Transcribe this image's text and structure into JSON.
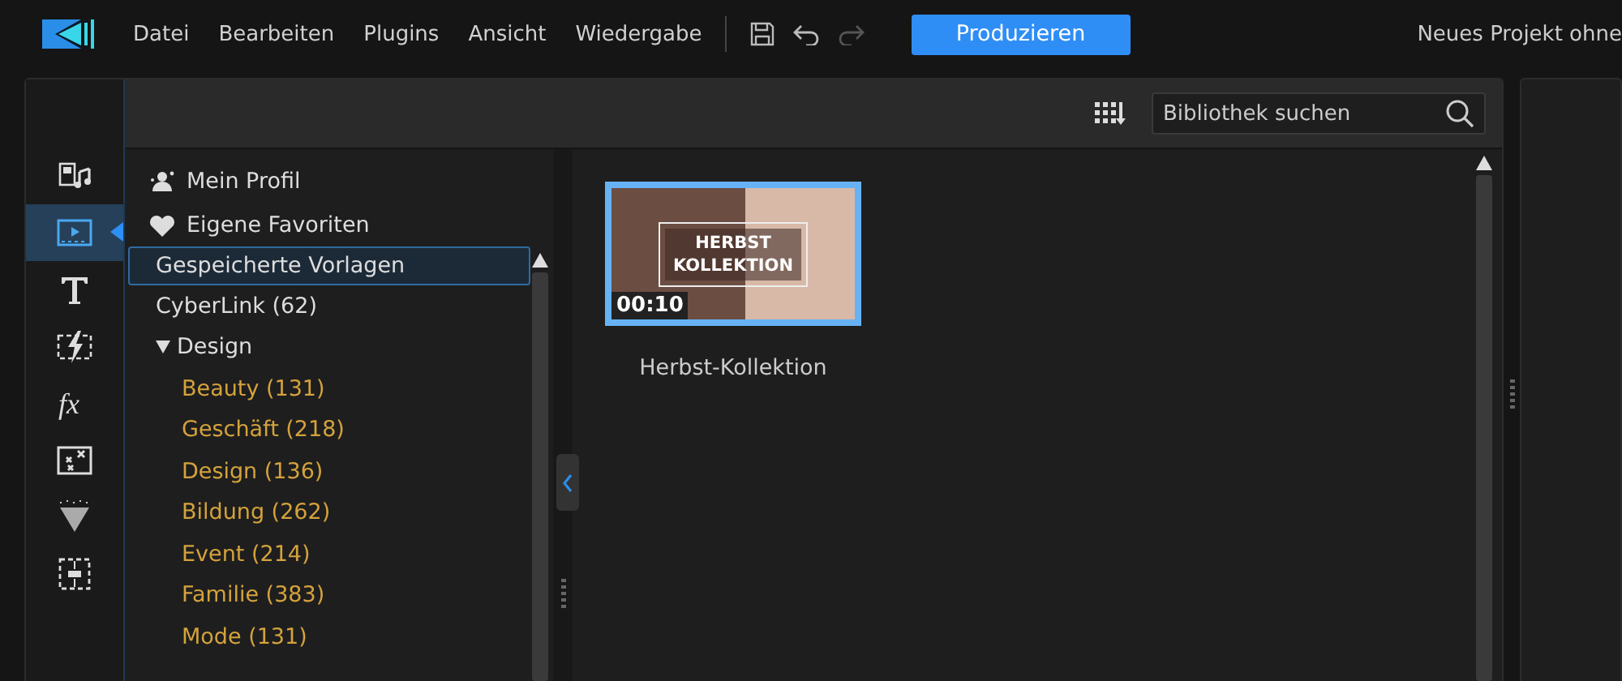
{
  "menu": [
    "Datei",
    "Bearbeiten",
    "Plugins",
    "Ansicht",
    "Wiedergabe"
  ],
  "produce_button": "Produzieren",
  "project_title": "Neues Projekt ohne",
  "search": {
    "placeholder": "Bibliothek suchen"
  },
  "rooms": [
    {
      "kind": "media",
      "selected": false
    },
    {
      "kind": "template",
      "selected": true
    },
    {
      "kind": "title",
      "selected": false
    },
    {
      "kind": "transition",
      "selected": false
    },
    {
      "kind": "fx",
      "selected": false
    },
    {
      "kind": "particle",
      "selected": false
    },
    {
      "kind": "spray",
      "selected": false
    },
    {
      "kind": "pip",
      "selected": false
    }
  ],
  "shortcuts": [
    {
      "kind": "profile",
      "label": "Mein Profil"
    },
    {
      "kind": "favorite",
      "label": "Eigene Favoriten"
    }
  ],
  "tree": [
    {
      "label": "Gespeicherte Vorlagen",
      "selected": true
    },
    {
      "label": "CyberLink  (62)",
      "selected": false
    },
    {
      "label": "Design",
      "selected": false,
      "expanded": true,
      "children": [
        {
          "label": "Beauty  (131)",
          "selected": false
        },
        {
          "label": "Geschäft  (218)",
          "selected": false
        },
        {
          "label": "Design  (136)",
          "selected": false
        },
        {
          "label": "Bildung  (262)",
          "selected": false
        },
        {
          "label": "Event  (214)",
          "selected": false
        },
        {
          "label": "Familie  (383)",
          "selected": false
        },
        {
          "label": "Mode  (131)",
          "selected": false
        }
      ]
    }
  ],
  "templates": [
    {
      "title": "Herbst-Kollektion",
      "thumb_text": "HERBST KOLLEKTION",
      "duration": "00:10",
      "selected": true
    }
  ]
}
